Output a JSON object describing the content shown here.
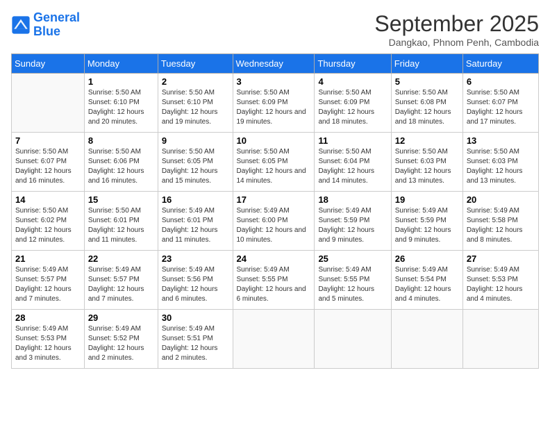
{
  "header": {
    "logo_line1": "General",
    "logo_line2": "Blue",
    "month": "September 2025",
    "location": "Dangkao, Phnom Penh, Cambodia"
  },
  "days_of_week": [
    "Sunday",
    "Monday",
    "Tuesday",
    "Wednesday",
    "Thursday",
    "Friday",
    "Saturday"
  ],
  "weeks": [
    [
      {
        "day": "",
        "sunrise": "",
        "sunset": "",
        "daylight": ""
      },
      {
        "day": "1",
        "sunrise": "Sunrise: 5:50 AM",
        "sunset": "Sunset: 6:10 PM",
        "daylight": "Daylight: 12 hours and 20 minutes."
      },
      {
        "day": "2",
        "sunrise": "Sunrise: 5:50 AM",
        "sunset": "Sunset: 6:10 PM",
        "daylight": "Daylight: 12 hours and 19 minutes."
      },
      {
        "day": "3",
        "sunrise": "Sunrise: 5:50 AM",
        "sunset": "Sunset: 6:09 PM",
        "daylight": "Daylight: 12 hours and 19 minutes."
      },
      {
        "day": "4",
        "sunrise": "Sunrise: 5:50 AM",
        "sunset": "Sunset: 6:09 PM",
        "daylight": "Daylight: 12 hours and 18 minutes."
      },
      {
        "day": "5",
        "sunrise": "Sunrise: 5:50 AM",
        "sunset": "Sunset: 6:08 PM",
        "daylight": "Daylight: 12 hours and 18 minutes."
      },
      {
        "day": "6",
        "sunrise": "Sunrise: 5:50 AM",
        "sunset": "Sunset: 6:07 PM",
        "daylight": "Daylight: 12 hours and 17 minutes."
      }
    ],
    [
      {
        "day": "7",
        "sunrise": "Sunrise: 5:50 AM",
        "sunset": "Sunset: 6:07 PM",
        "daylight": "Daylight: 12 hours and 16 minutes."
      },
      {
        "day": "8",
        "sunrise": "Sunrise: 5:50 AM",
        "sunset": "Sunset: 6:06 PM",
        "daylight": "Daylight: 12 hours and 16 minutes."
      },
      {
        "day": "9",
        "sunrise": "Sunrise: 5:50 AM",
        "sunset": "Sunset: 6:05 PM",
        "daylight": "Daylight: 12 hours and 15 minutes."
      },
      {
        "day": "10",
        "sunrise": "Sunrise: 5:50 AM",
        "sunset": "Sunset: 6:05 PM",
        "daylight": "Daylight: 12 hours and 14 minutes."
      },
      {
        "day": "11",
        "sunrise": "Sunrise: 5:50 AM",
        "sunset": "Sunset: 6:04 PM",
        "daylight": "Daylight: 12 hours and 14 minutes."
      },
      {
        "day": "12",
        "sunrise": "Sunrise: 5:50 AM",
        "sunset": "Sunset: 6:03 PM",
        "daylight": "Daylight: 12 hours and 13 minutes."
      },
      {
        "day": "13",
        "sunrise": "Sunrise: 5:50 AM",
        "sunset": "Sunset: 6:03 PM",
        "daylight": "Daylight: 12 hours and 13 minutes."
      }
    ],
    [
      {
        "day": "14",
        "sunrise": "Sunrise: 5:50 AM",
        "sunset": "Sunset: 6:02 PM",
        "daylight": "Daylight: 12 hours and 12 minutes."
      },
      {
        "day": "15",
        "sunrise": "Sunrise: 5:50 AM",
        "sunset": "Sunset: 6:01 PM",
        "daylight": "Daylight: 12 hours and 11 minutes."
      },
      {
        "day": "16",
        "sunrise": "Sunrise: 5:49 AM",
        "sunset": "Sunset: 6:01 PM",
        "daylight": "Daylight: 12 hours and 11 minutes."
      },
      {
        "day": "17",
        "sunrise": "Sunrise: 5:49 AM",
        "sunset": "Sunset: 6:00 PM",
        "daylight": "Daylight: 12 hours and 10 minutes."
      },
      {
        "day": "18",
        "sunrise": "Sunrise: 5:49 AM",
        "sunset": "Sunset: 5:59 PM",
        "daylight": "Daylight: 12 hours and 9 minutes."
      },
      {
        "day": "19",
        "sunrise": "Sunrise: 5:49 AM",
        "sunset": "Sunset: 5:59 PM",
        "daylight": "Daylight: 12 hours and 9 minutes."
      },
      {
        "day": "20",
        "sunrise": "Sunrise: 5:49 AM",
        "sunset": "Sunset: 5:58 PM",
        "daylight": "Daylight: 12 hours and 8 minutes."
      }
    ],
    [
      {
        "day": "21",
        "sunrise": "Sunrise: 5:49 AM",
        "sunset": "Sunset: 5:57 PM",
        "daylight": "Daylight: 12 hours and 7 minutes."
      },
      {
        "day": "22",
        "sunrise": "Sunrise: 5:49 AM",
        "sunset": "Sunset: 5:57 PM",
        "daylight": "Daylight: 12 hours and 7 minutes."
      },
      {
        "day": "23",
        "sunrise": "Sunrise: 5:49 AM",
        "sunset": "Sunset: 5:56 PM",
        "daylight": "Daylight: 12 hours and 6 minutes."
      },
      {
        "day": "24",
        "sunrise": "Sunrise: 5:49 AM",
        "sunset": "Sunset: 5:55 PM",
        "daylight": "Daylight: 12 hours and 6 minutes."
      },
      {
        "day": "25",
        "sunrise": "Sunrise: 5:49 AM",
        "sunset": "Sunset: 5:55 PM",
        "daylight": "Daylight: 12 hours and 5 minutes."
      },
      {
        "day": "26",
        "sunrise": "Sunrise: 5:49 AM",
        "sunset": "Sunset: 5:54 PM",
        "daylight": "Daylight: 12 hours and 4 minutes."
      },
      {
        "day": "27",
        "sunrise": "Sunrise: 5:49 AM",
        "sunset": "Sunset: 5:53 PM",
        "daylight": "Daylight: 12 hours and 4 minutes."
      }
    ],
    [
      {
        "day": "28",
        "sunrise": "Sunrise: 5:49 AM",
        "sunset": "Sunset: 5:53 PM",
        "daylight": "Daylight: 12 hours and 3 minutes."
      },
      {
        "day": "29",
        "sunrise": "Sunrise: 5:49 AM",
        "sunset": "Sunset: 5:52 PM",
        "daylight": "Daylight: 12 hours and 2 minutes."
      },
      {
        "day": "30",
        "sunrise": "Sunrise: 5:49 AM",
        "sunset": "Sunset: 5:51 PM",
        "daylight": "Daylight: 12 hours and 2 minutes."
      },
      {
        "day": "",
        "sunrise": "",
        "sunset": "",
        "daylight": ""
      },
      {
        "day": "",
        "sunrise": "",
        "sunset": "",
        "daylight": ""
      },
      {
        "day": "",
        "sunrise": "",
        "sunset": "",
        "daylight": ""
      },
      {
        "day": "",
        "sunrise": "",
        "sunset": "",
        "daylight": ""
      }
    ]
  ]
}
